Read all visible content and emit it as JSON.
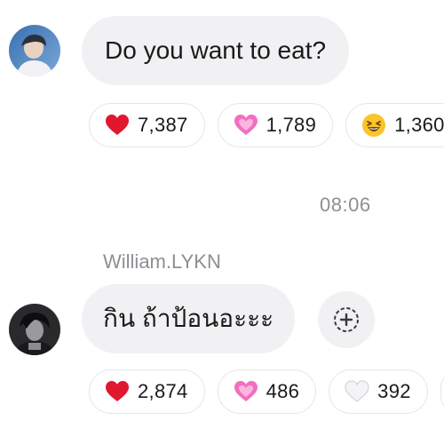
{
  "messages": [
    {
      "text": "Do you want to eat?",
      "reactions": [
        {
          "emoji": "red-heart",
          "count": "7,387"
        },
        {
          "emoji": "pink-heart",
          "count": "1,789"
        },
        {
          "emoji": "laughing-face",
          "count": "1,360"
        }
      ]
    },
    {
      "sender": "William.LYKN",
      "text": "กิน ถ้าป้อนอะะะ",
      "reactions": [
        {
          "emoji": "red-heart",
          "count": "2,874"
        },
        {
          "emoji": "pink-heart",
          "count": "486"
        },
        {
          "emoji": "white-heart",
          "count": "392"
        }
      ]
    }
  ],
  "timestamp": "08:06",
  "add_reaction_icon": "add-reaction-icon",
  "colors": {
    "bubble": "#f1f1f3",
    "meta_text": "#8e8e93",
    "red_heart": "#e0182e",
    "pink_heart": "#f26fc0",
    "laughing_face": "#f9c52b"
  }
}
